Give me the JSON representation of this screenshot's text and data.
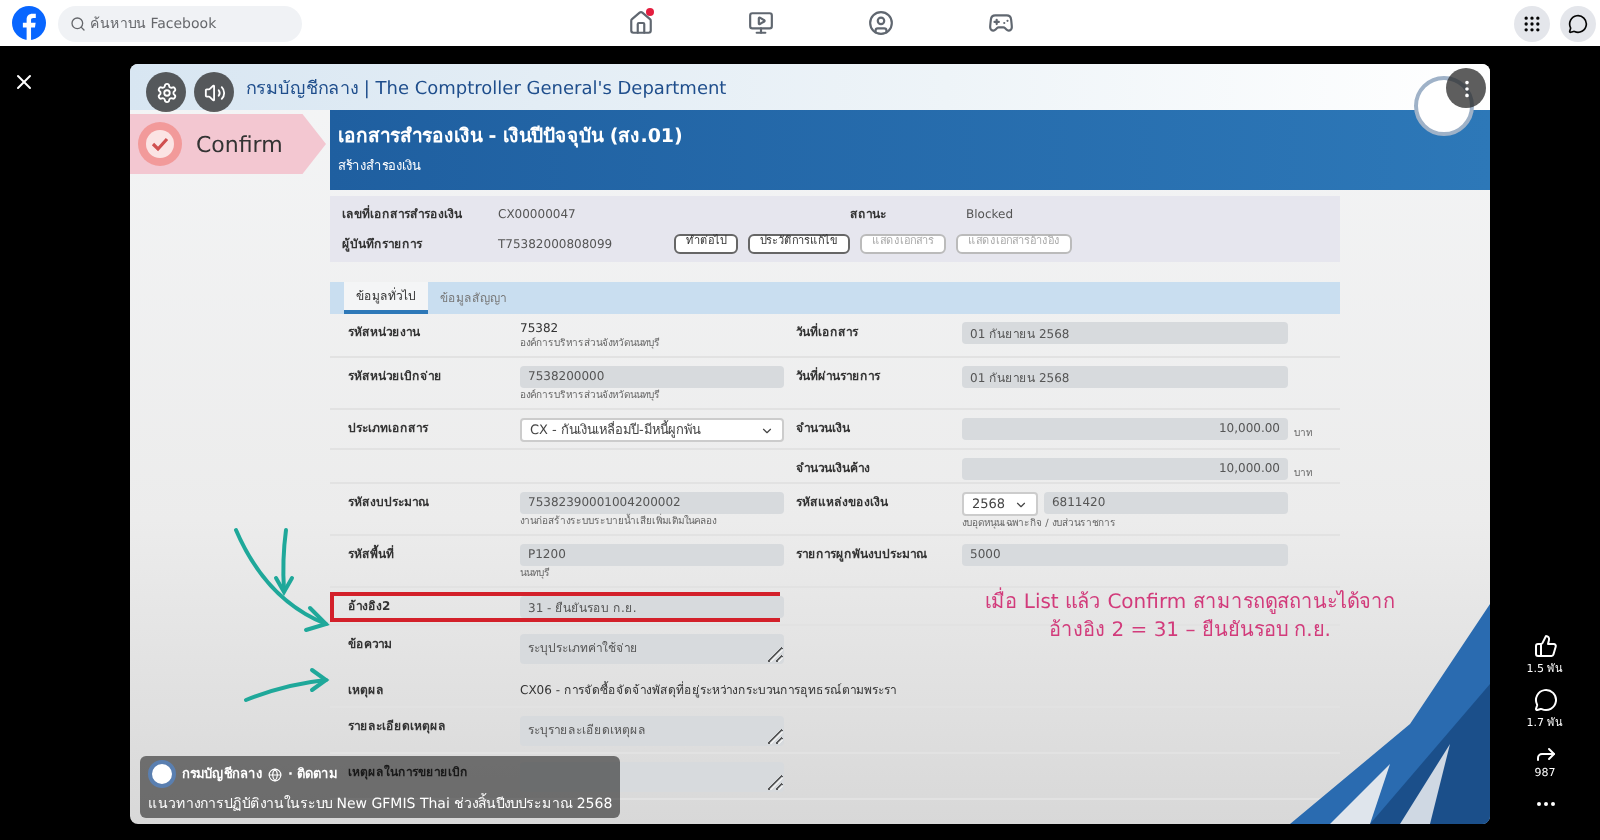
{
  "topbar": {
    "search": {
      "placeholder": "ค้นหาบน Facebook"
    },
    "nav": [
      {
        "kind": "home",
        "notification": true
      },
      {
        "kind": "video",
        "notification": false
      },
      {
        "kind": "groups",
        "notification": false
      },
      {
        "kind": "gaming",
        "notification": false
      }
    ],
    "tools": [
      {
        "kind": "apps"
      },
      {
        "kind": "messenger"
      }
    ]
  },
  "video": {
    "header": "กรมบัญชีกลาง | The Comptroller General's Department",
    "badge": "Confirm",
    "title": "เอกสารสำรองเงิน - เงินปีปัจจุบัน (สง.01)",
    "subtitle": "สร้างสำรองเงิน",
    "info": {
      "doc_label": "เลขที่เอกสารสำรองเงิน",
      "doc_value": "CX00000047",
      "status_label": "สถานะ",
      "status_value": "Blocked",
      "user_label": "ผู้บันทึกรายการ",
      "user_value": "T75382000808099",
      "buttons": [
        {
          "label": "ทำต่อไป",
          "disabled": false
        },
        {
          "label": "ประวัติการแก้ไข",
          "disabled": false
        },
        {
          "label": "แสดงเอกสาร",
          "disabled": true
        },
        {
          "label": "แสดงเอกสารอ้างอิง",
          "disabled": true
        }
      ]
    },
    "tabs": [
      {
        "label": "ข้อมูลทั่วไป",
        "selected": true
      },
      {
        "label": "ข้อมูลสัญญา",
        "selected": false
      }
    ],
    "rows": [
      {
        "highlighted": false,
        "left": {
          "label": "รหัสหน่วยงาน",
          "kind": "text",
          "value": "75382",
          "note": "องค์การบริหารส่วนจังหวัดนนทบุรี"
        },
        "right": {
          "label": "วันที่เอกสาร",
          "kind": "input",
          "value": "01 กันยายน 2568"
        }
      },
      {
        "highlighted": false,
        "left": {
          "label": "รหัสหน่วยเบิกจ่าย",
          "kind": "input",
          "value": "7538200000",
          "note": "องค์การบริหารส่วนจังหวัดนนทบุรี"
        },
        "right": {
          "label": "วันที่ผ่านรายการ",
          "kind": "input",
          "value": "01 กันยายน 2568"
        }
      },
      {
        "highlighted": false,
        "left": {
          "label": "ประเภทเอกสาร",
          "kind": "select",
          "value": "CX - กันเงินเหลื่อมปี-มีหนี้ผูกพัน"
        },
        "right": {
          "label": "จำนวนเงิน",
          "kind": "amount",
          "value": "10,000.00",
          "unit": "บาท"
        }
      },
      {
        "right": {
          "label": "จำนวนเงินค้าง",
          "kind": "amount",
          "value": "10,000.00",
          "unit": "บาท"
        }
      },
      {
        "highlighted": false,
        "left": {
          "label": "รหัสงบประมาณ",
          "kind": "input",
          "value": "75382390001004200002",
          "note": "งานก่อสร้างระบบระบายน้ำเสียเพิ่มเติมในคลอง"
        },
        "right": {
          "label": "รหัสแหล่งของเงิน",
          "kind": "source",
          "year": "2568",
          "value": "6811420",
          "note": "งบอุดหนุนเฉพาะกิจ / งบส่วนราชการ"
        }
      },
      {
        "highlighted": false,
        "left": {
          "label": "รหัสพื้นที่",
          "kind": "input",
          "value": "P1200",
          "note": "นนทบุรี"
        },
        "right": {
          "label": "รายการผูกพันงบประมาณ",
          "kind": "input",
          "value": "5000"
        }
      },
      {
        "highlighted": true,
        "left": {
          "label": "อ้างอิง2",
          "kind": "input",
          "value": "31 - ยืนยันรอบ ก.ย."
        }
      },
      {
        "highlighted": false,
        "left": {
          "label": "ข้อความ",
          "kind": "textarea",
          "placeholder": "ระบุประเภทค่าใช้จ่าย"
        }
      },
      {
        "highlighted": false,
        "left": {
          "label": "เหตุผล",
          "kind": "text",
          "value": "CX06 - การจัดซื้อจัดจ้างพัสดุที่อยู่ระหว่างกระบวนการอุทธรณ์ตามพระรา"
        }
      },
      {
        "highlighted": false,
        "left": {
          "label": "รายละเอียดเหตุผล",
          "kind": "textarea",
          "placeholder": "ระบุรายละเอียดเหตุผล"
        }
      },
      {
        "highlighted": false,
        "left": {
          "label": "เหตุผลในการขยายเบิก",
          "kind": "textarea"
        }
      }
    ],
    "annotation": [
      "เมื่อ List แล้ว Confirm สามารถดูสถานะได้จาก",
      "อ้างอิง 2 = 31 – ยืนยันรอบ ก.ย."
    ],
    "footer": {
      "page": "กรมบัญชีกลาง",
      "follow": "· ติดตาม",
      "caption": "แนวทางการปฏิบัติงานในระบบ New GFMIS Thai ช่วงสิ้นปีงบประมาณ 2568"
    }
  },
  "actions": [
    {
      "kind": "like",
      "count": "1.5 พัน"
    },
    {
      "kind": "comment",
      "count": "1.7 พัน"
    },
    {
      "kind": "share",
      "count": "987"
    },
    {
      "kind": "more"
    }
  ]
}
